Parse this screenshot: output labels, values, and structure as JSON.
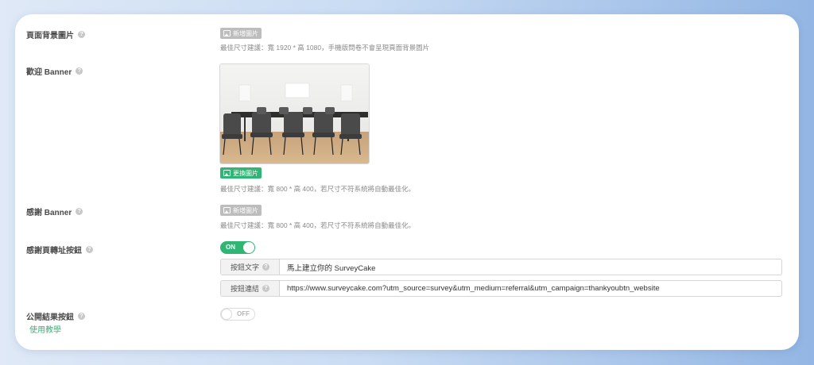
{
  "page_background": {
    "label": "頁面背景圖片",
    "add_button": "新增圖片",
    "hint": "最佳尺寸建議：寬 1920 * 高 1080，手機版問卷不會呈現頁面背景圖片"
  },
  "welcome_banner": {
    "label": "歡迎 Banner",
    "replace_button": "更換圖片",
    "hint": "最佳尺寸建議：寬 800 * 高 400，若尺寸不符系統將自動最佳化。"
  },
  "thanks_banner": {
    "label": "感謝 Banner",
    "add_button": "新增圖片",
    "hint": "最佳尺寸建議：寬 800 * 高 400，若尺寸不符系統將自動最佳化。"
  },
  "redirect_button": {
    "label": "感謝頁轉址按鈕",
    "toggle": "ON",
    "text_addon": "按鈕文字",
    "text_value": "馬上建立你的 SurveyCake",
    "link_addon": "按鈕連結",
    "link_value": "https://www.surveycake.com?utm_source=survey&utm_medium=referral&utm_campaign=thankyoubtn_website"
  },
  "public_result": {
    "label": "公開結果按鈕",
    "toggle": "OFF",
    "tutorial_link": "使用教學"
  },
  "colors": {
    "accent_green": "#2fb574",
    "disabled_gray": "#bdbdbd"
  }
}
